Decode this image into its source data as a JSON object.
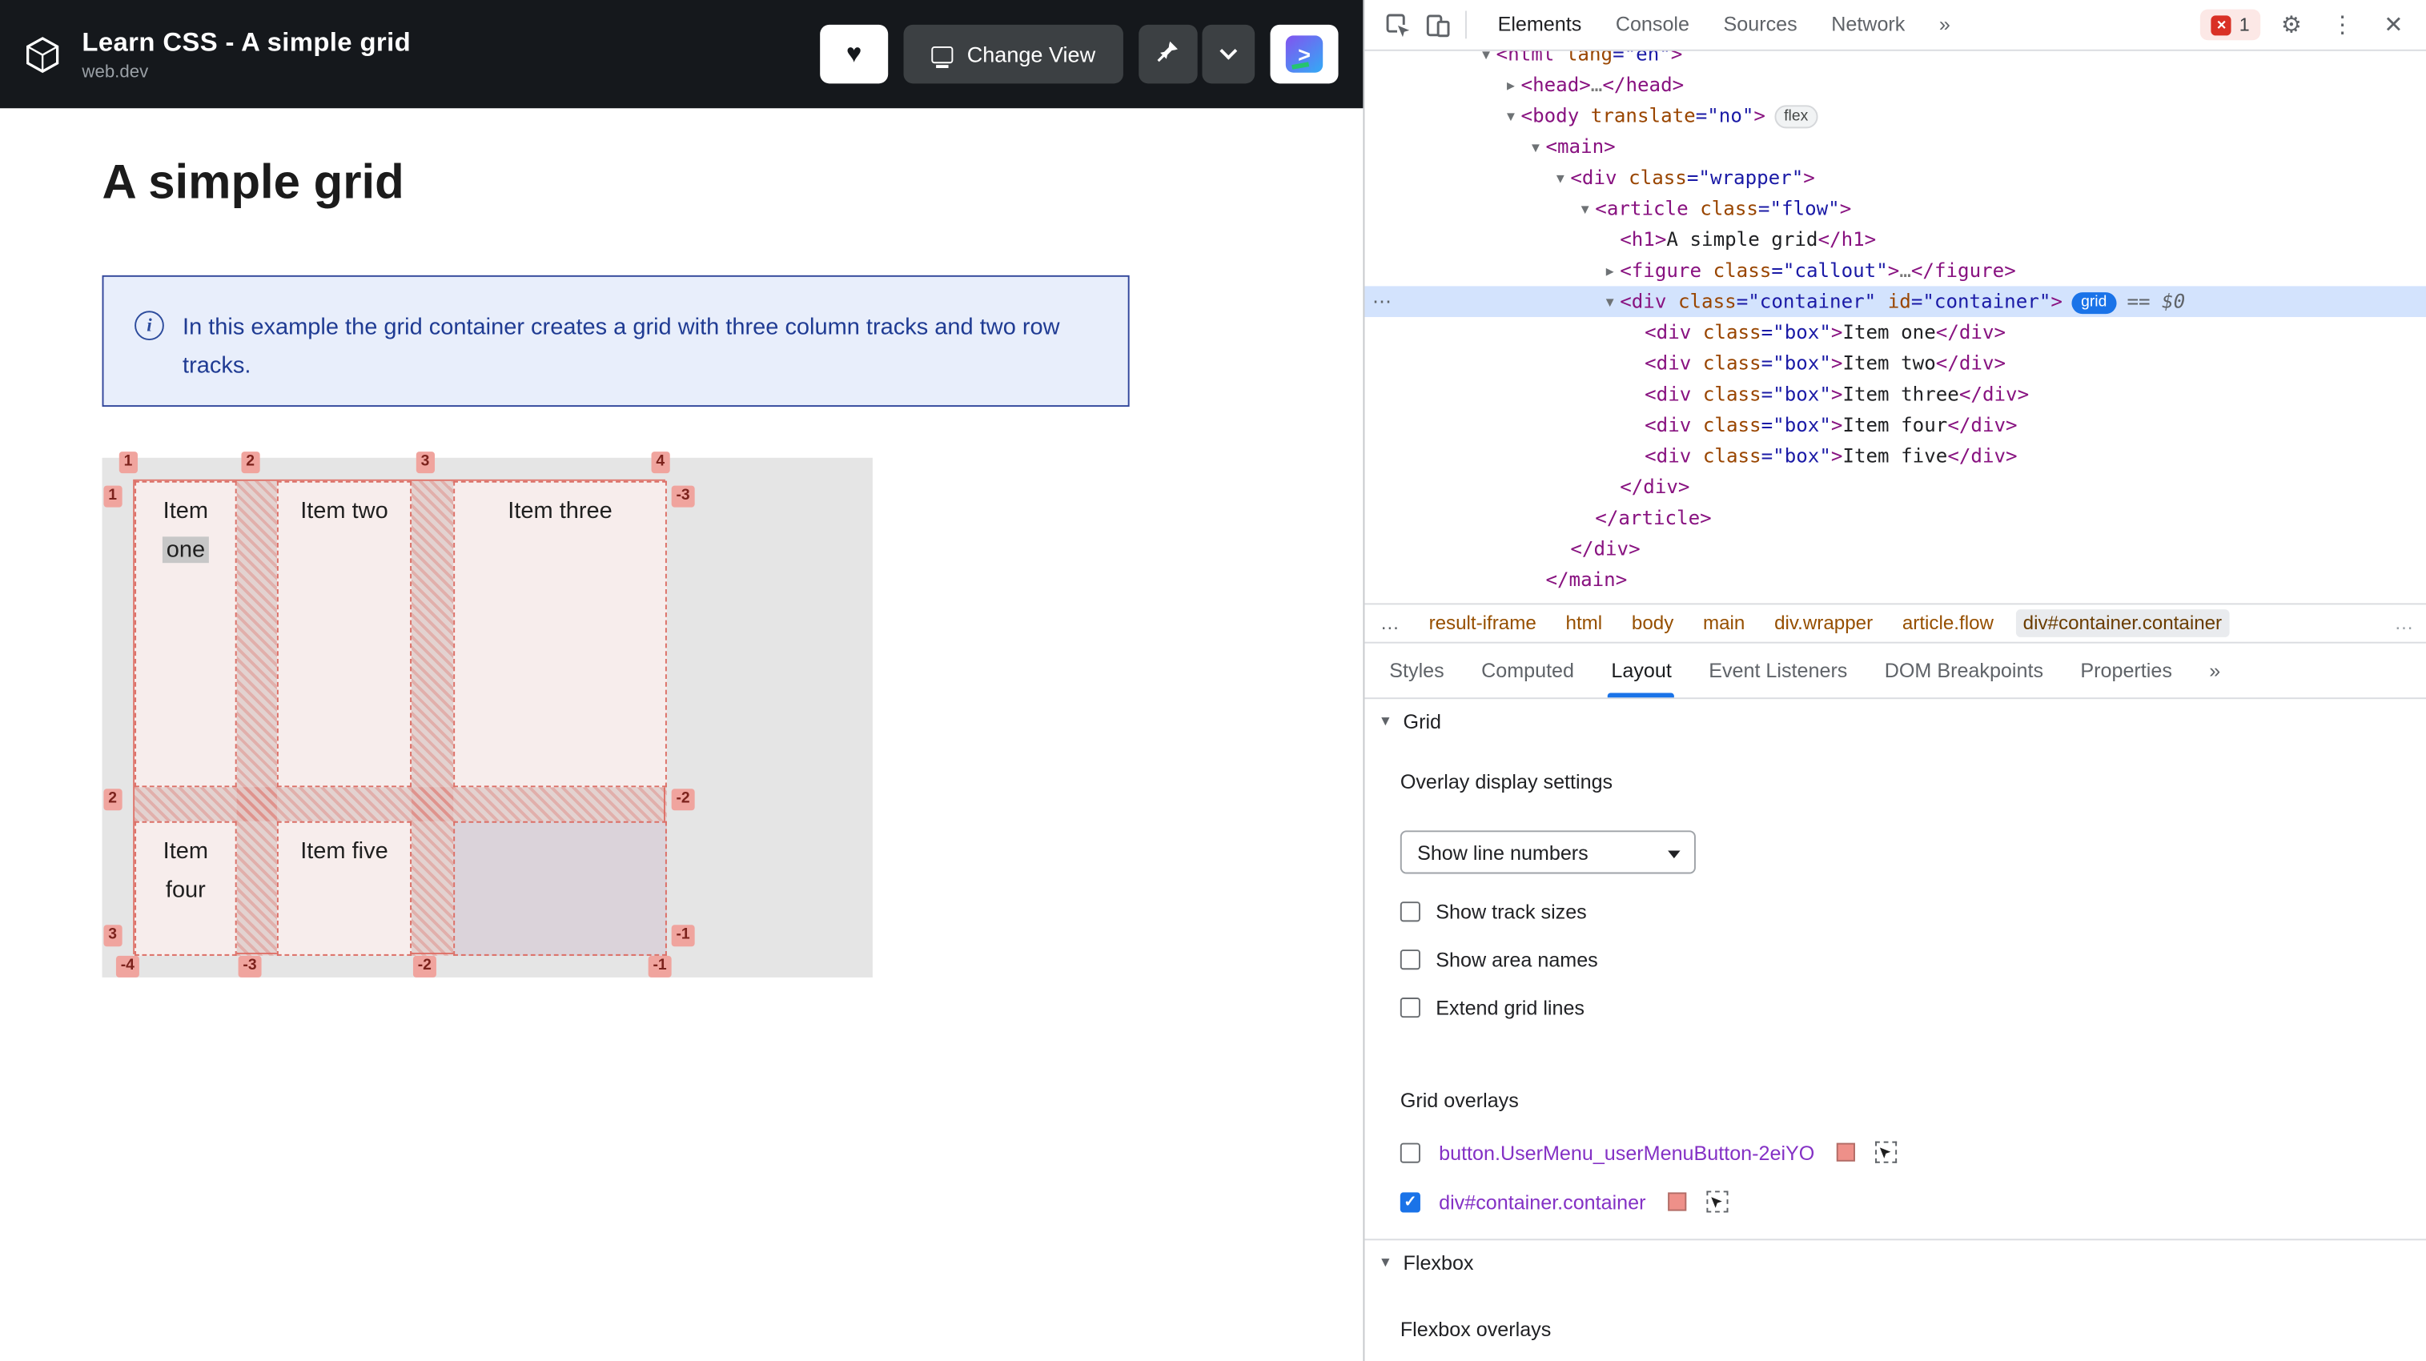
{
  "icons": {
    "heart": "♥",
    "gear": "⚙",
    "kebab": "⋮",
    "close": "✕",
    "check": "✓",
    "info": "i",
    "gutter_dots": "⋯",
    "triangle_down": "▼",
    "triangle_right": "▶",
    "run_arrow": ">"
  },
  "app_header": {
    "title": "Learn CSS - A simple grid",
    "subtitle": "web.dev",
    "change_view_label": "Change View"
  },
  "content": {
    "heading": "A simple grid",
    "callout": "In this example the grid container creates a grid with three column tracks and two row tracks.",
    "grid": {
      "items": [
        {
          "lines": [
            "Item",
            "one"
          ],
          "highlight_line": 1
        },
        {
          "lines": [
            "Item two"
          ]
        },
        {
          "lines": [
            "Item three"
          ]
        },
        {
          "lines": [
            "Item",
            "four"
          ]
        },
        {
          "lines": [
            "Item five"
          ]
        }
      ],
      "line_numbers": {
        "top": [
          "1",
          "2",
          "3",
          "4"
        ],
        "left": [
          "1",
          "2",
          "3"
        ],
        "right": [
          "-3",
          "-2",
          "-1"
        ],
        "bottom": [
          "-4",
          "-3",
          "-2",
          "-1"
        ]
      }
    }
  },
  "devtools": {
    "toolbar": {
      "tabs": [
        {
          "label": "Elements",
          "active": true
        },
        {
          "label": "Console"
        },
        {
          "label": "Sources"
        },
        {
          "label": "Network"
        }
      ],
      "more": "»",
      "error_count": "1"
    },
    "tree": [
      {
        "indent": 0,
        "arrow": "open",
        "clipped": true,
        "tokens": [
          [
            "t",
            "<html "
          ],
          [
            "a",
            "lang"
          ],
          [
            "v",
            "=\"en\""
          ],
          [
            "t",
            ">"
          ]
        ]
      },
      {
        "indent": 1,
        "arrow": "closed",
        "tokens": [
          [
            "t",
            "<head>"
          ],
          [
            "d",
            "…"
          ],
          [
            "t",
            "</head>"
          ]
        ]
      },
      {
        "indent": 1,
        "arrow": "open",
        "badge": "flex",
        "tokens": [
          [
            "t",
            "<body "
          ],
          [
            "a",
            "translate"
          ],
          [
            "v",
            "=\"no\""
          ],
          [
            "t",
            ">"
          ]
        ]
      },
      {
        "indent": 2,
        "arrow": "open",
        "tokens": [
          [
            "t",
            "<main>"
          ]
        ]
      },
      {
        "indent": 3,
        "arrow": "open",
        "tokens": [
          [
            "t",
            "<div "
          ],
          [
            "a",
            "class"
          ],
          [
            "v",
            "=\"wrapper\""
          ],
          [
            "t",
            ">"
          ]
        ]
      },
      {
        "indent": 4,
        "arrow": "open",
        "tokens": [
          [
            "t",
            "<article "
          ],
          [
            "a",
            "class"
          ],
          [
            "v",
            "=\"flow\""
          ],
          [
            "t",
            ">"
          ]
        ]
      },
      {
        "indent": 5,
        "tokens": [
          [
            "t",
            "<h1>"
          ],
          [
            "x",
            "A simple grid"
          ],
          [
            "t",
            "</h1>"
          ]
        ]
      },
      {
        "indent": 5,
        "arrow": "closed",
        "tokens": [
          [
            "t",
            "<figure "
          ],
          [
            "a",
            "class"
          ],
          [
            "v",
            "=\"callout\""
          ],
          [
            "t",
            ">"
          ],
          [
            "d",
            "…"
          ],
          [
            "t",
            "</figure>"
          ]
        ]
      },
      {
        "indent": 5,
        "arrow": "open",
        "selected": true,
        "badge": "grid",
        "suffix": "== $0",
        "tokens": [
          [
            "t",
            "<div "
          ],
          [
            "a",
            "class"
          ],
          [
            "v",
            "=\"container\""
          ],
          [
            "a",
            " id"
          ],
          [
            "v",
            "=\"container\""
          ],
          [
            "t",
            ">"
          ]
        ]
      },
      {
        "indent": 6,
        "tokens": [
          [
            "t",
            "<div "
          ],
          [
            "a",
            "class"
          ],
          [
            "v",
            "=\"box\""
          ],
          [
            "t",
            ">"
          ],
          [
            "x",
            "Item one"
          ],
          [
            "t",
            "</div>"
          ]
        ]
      },
      {
        "indent": 6,
        "tokens": [
          [
            "t",
            "<div "
          ],
          [
            "a",
            "class"
          ],
          [
            "v",
            "=\"box\""
          ],
          [
            "t",
            ">"
          ],
          [
            "x",
            "Item two"
          ],
          [
            "t",
            "</div>"
          ]
        ]
      },
      {
        "indent": 6,
        "tokens": [
          [
            "t",
            "<div "
          ],
          [
            "a",
            "class"
          ],
          [
            "v",
            "=\"box\""
          ],
          [
            "t",
            ">"
          ],
          [
            "x",
            "Item three"
          ],
          [
            "t",
            "</div>"
          ]
        ]
      },
      {
        "indent": 6,
        "tokens": [
          [
            "t",
            "<div "
          ],
          [
            "a",
            "class"
          ],
          [
            "v",
            "=\"box\""
          ],
          [
            "t",
            ">"
          ],
          [
            "x",
            "Item four"
          ],
          [
            "t",
            "</div>"
          ]
        ]
      },
      {
        "indent": 6,
        "tokens": [
          [
            "t",
            "<div "
          ],
          [
            "a",
            "class"
          ],
          [
            "v",
            "=\"box\""
          ],
          [
            "t",
            ">"
          ],
          [
            "x",
            "Item five"
          ],
          [
            "t",
            "</div>"
          ]
        ]
      },
      {
        "indent": 5,
        "tokens": [
          [
            "t",
            "</div>"
          ]
        ]
      },
      {
        "indent": 4,
        "tokens": [
          [
            "t",
            "</article>"
          ]
        ]
      },
      {
        "indent": 3,
        "tokens": [
          [
            "t",
            "</div>"
          ]
        ]
      },
      {
        "indent": 2,
        "tokens": [
          [
            "t",
            "</main>"
          ]
        ]
      }
    ],
    "crumbs": [
      {
        "label": "…",
        "dim": true
      },
      {
        "label": "result-iframe"
      },
      {
        "label": "html"
      },
      {
        "label": "body"
      },
      {
        "label": "main"
      },
      {
        "label": "div.wrapper"
      },
      {
        "label": "article.flow"
      },
      {
        "label": "div#container.container",
        "selected": true
      }
    ],
    "crumb_more": "…",
    "panel_tabs": [
      {
        "label": "Styles"
      },
      {
        "label": "Computed"
      },
      {
        "label": "Layout",
        "active": true
      },
      {
        "label": "Event Listeners"
      },
      {
        "label": "DOM Breakpoints"
      },
      {
        "label": "Properties"
      },
      {
        "label": "»"
      }
    ],
    "layout_pane": {
      "grid_header": "Grid",
      "overlay_settings": "Overlay display settings",
      "dropdown_value": "Show line numbers",
      "options": [
        {
          "label": "Show track sizes",
          "checked": false
        },
        {
          "label": "Show area names",
          "checked": false
        },
        {
          "label": "Extend grid lines",
          "checked": false
        }
      ],
      "grid_overlays_header": "Grid overlays",
      "overlays": [
        {
          "label": "button.UserMenu_userMenuButton-2eiYO",
          "checked": false
        },
        {
          "label": "div#container.container",
          "checked": true
        }
      ],
      "flexbox_header": "Flexbox",
      "flexbox_overlays_header": "Flexbox overlays"
    }
  },
  "colors": {
    "accent": "#1a73e8",
    "selection": "#d3e3fd",
    "grid_overlay": "#df756c",
    "error": "#d93025",
    "header_bg": "#15181c",
    "callout_bg": "#e8eefb",
    "callout_border": "#33479b",
    "overlay_label": "#8431c5",
    "swatch": "#ee9089"
  }
}
